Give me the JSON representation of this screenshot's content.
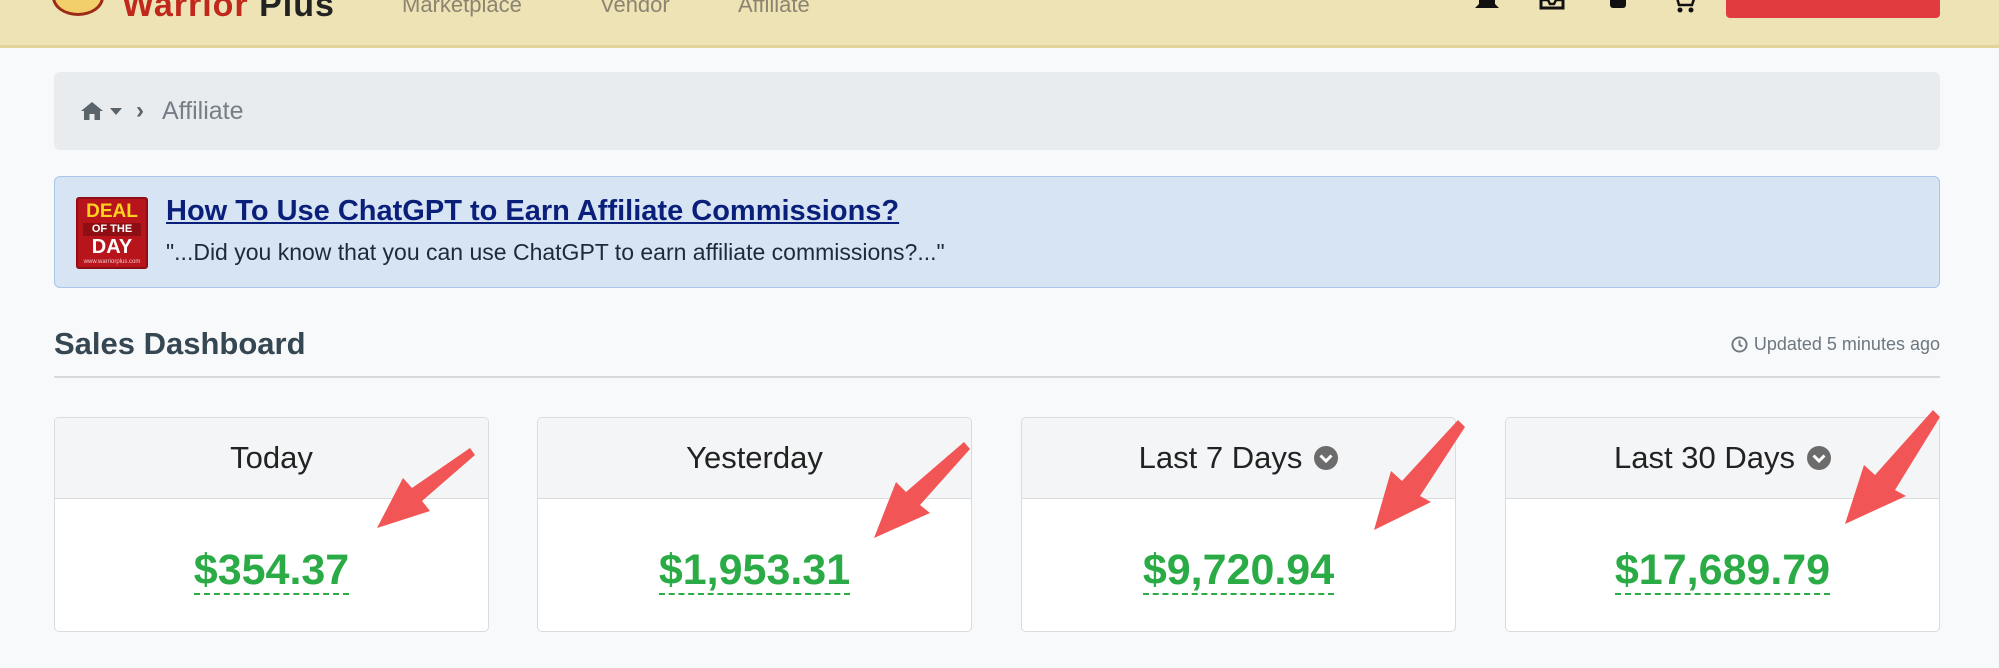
{
  "navbar": {
    "logo_word": "Warrior",
    "logo_plus": "Plus",
    "links": [
      "Marketplace",
      "Vendor",
      "Affiliate"
    ],
    "icons": [
      "bell-icon",
      "inbox-icon",
      "user-icon",
      "cart-icon"
    ],
    "brand_color": "#c0281c",
    "background": "#ede3b5"
  },
  "breadcrumb": {
    "current": "Affiliate"
  },
  "deal": {
    "badge": {
      "line1": "DEAL",
      "line2": "OF THE",
      "line3": "DAY",
      "line4": "www.warriorplus.com"
    },
    "title": "How To Use ChatGPT to Earn Affiliate Commissions?",
    "quote": "\"...Did you know that you can use ChatGPT to earn affiliate commissions?...\""
  },
  "dashboard": {
    "title": "Sales Dashboard",
    "updated": "Updated 5 minutes ago",
    "cards": [
      {
        "label": "Today",
        "value": "$354.37",
        "has_dropdown": false
      },
      {
        "label": "Yesterday",
        "value": "$1,953.31",
        "has_dropdown": false
      },
      {
        "label": "Last 7 Days",
        "value": "$9,720.94",
        "has_dropdown": true
      },
      {
        "label": "Last 30 Days",
        "value": "$17,689.79",
        "has_dropdown": true
      }
    ],
    "value_color": "#2aab45"
  },
  "annotations": {
    "arrow_color": "#f25555"
  }
}
